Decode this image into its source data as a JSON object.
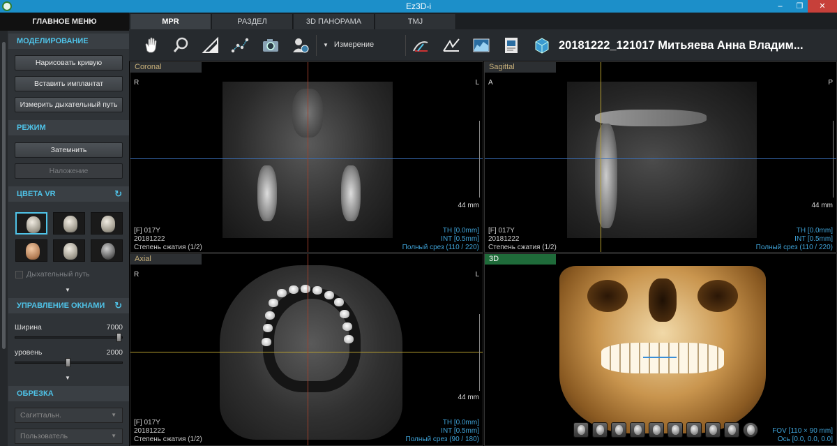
{
  "window": {
    "title": "Ez3D-i",
    "minimize": "–",
    "maximize": "❐",
    "close": "✕"
  },
  "sidebar": {
    "main_menu": "ГЛАВНОЕ МЕНЮ",
    "modeling": {
      "title": "МОДЕЛИРОВАНИЕ",
      "buttons": [
        "Нарисовать кривую",
        "Вставить имплантат",
        "Измерить дыхательный путь"
      ]
    },
    "mode": {
      "title": "РЕЖИМ",
      "buttons": [
        "Затемнить",
        "Наложение"
      ]
    },
    "vr_colors": {
      "title": "ЦВЕТА VR",
      "refresh_icon": "↻",
      "airway_checkbox_label": "Дыхательный путь",
      "expand_icon": "▼"
    },
    "window_control": {
      "title": "УПРАВЛЕНИЕ ОКНАМИ",
      "refresh_icon": "↻",
      "width_label": "Ширина",
      "width_value": "7000",
      "level_label": "уровень",
      "level_value": "2000",
      "expand_icon": "▼"
    },
    "crop": {
      "title": "ОБРЕЗКА",
      "dropdowns": [
        "Сагиттальн.",
        "Пользователь"
      ],
      "caret_icon": "▼"
    }
  },
  "tabs": [
    "MPR",
    "РАЗДЕЛ",
    "3D ПАНОРАМА",
    "TMJ"
  ],
  "toolbar": {
    "measure_label": "Измерение",
    "measure_caret": "▼",
    "patient": "20181222_121017 Митьяева Анна Владим..."
  },
  "viewports": {
    "coronal": {
      "label": "Coronal",
      "left": "R",
      "right": "L",
      "scale": "44 mm",
      "info_left": [
        "[F] 017Y",
        "20181222",
        "Степень сжатия (1/2)"
      ],
      "info_right": [
        "TH [0.0mm]",
        "INT [0.5mm]",
        "Полный срез (110 / 220)"
      ]
    },
    "sagittal": {
      "label": "Sagittal",
      "left": "A",
      "right": "P",
      "scale": "44 mm",
      "info_left": [
        "[F] 017Y",
        "20181222",
        "Степень сжатия (1/2)"
      ],
      "info_right": [
        "TH [0.0mm]",
        "INT [0.5mm]",
        "Полный срез (110 / 220)"
      ]
    },
    "axial": {
      "label": "Axial",
      "left": "R",
      "right": "L",
      "scale": "44 mm",
      "info_left": [
        "[F] 017Y",
        "20181222",
        "Степень сжатия (1/2)"
      ],
      "info_right": [
        "TH [0.0mm]",
        "INT [0.5mm]",
        "Полный срез (90 / 180)"
      ]
    },
    "three_d": {
      "label": "3D",
      "info_right": [
        "FOV [110 × 90 mm]",
        "Ось [0.0, 0.0, 0.0]"
      ]
    }
  },
  "colors": {
    "accent": "#4fc3e8",
    "titlebar": "#1c8fc9",
    "crosshair_blue": "#3a6fb8",
    "crosshair_red": "#a0402c",
    "crosshair_yellow": "#b8a030",
    "info_blue": "#3fa3d8"
  }
}
